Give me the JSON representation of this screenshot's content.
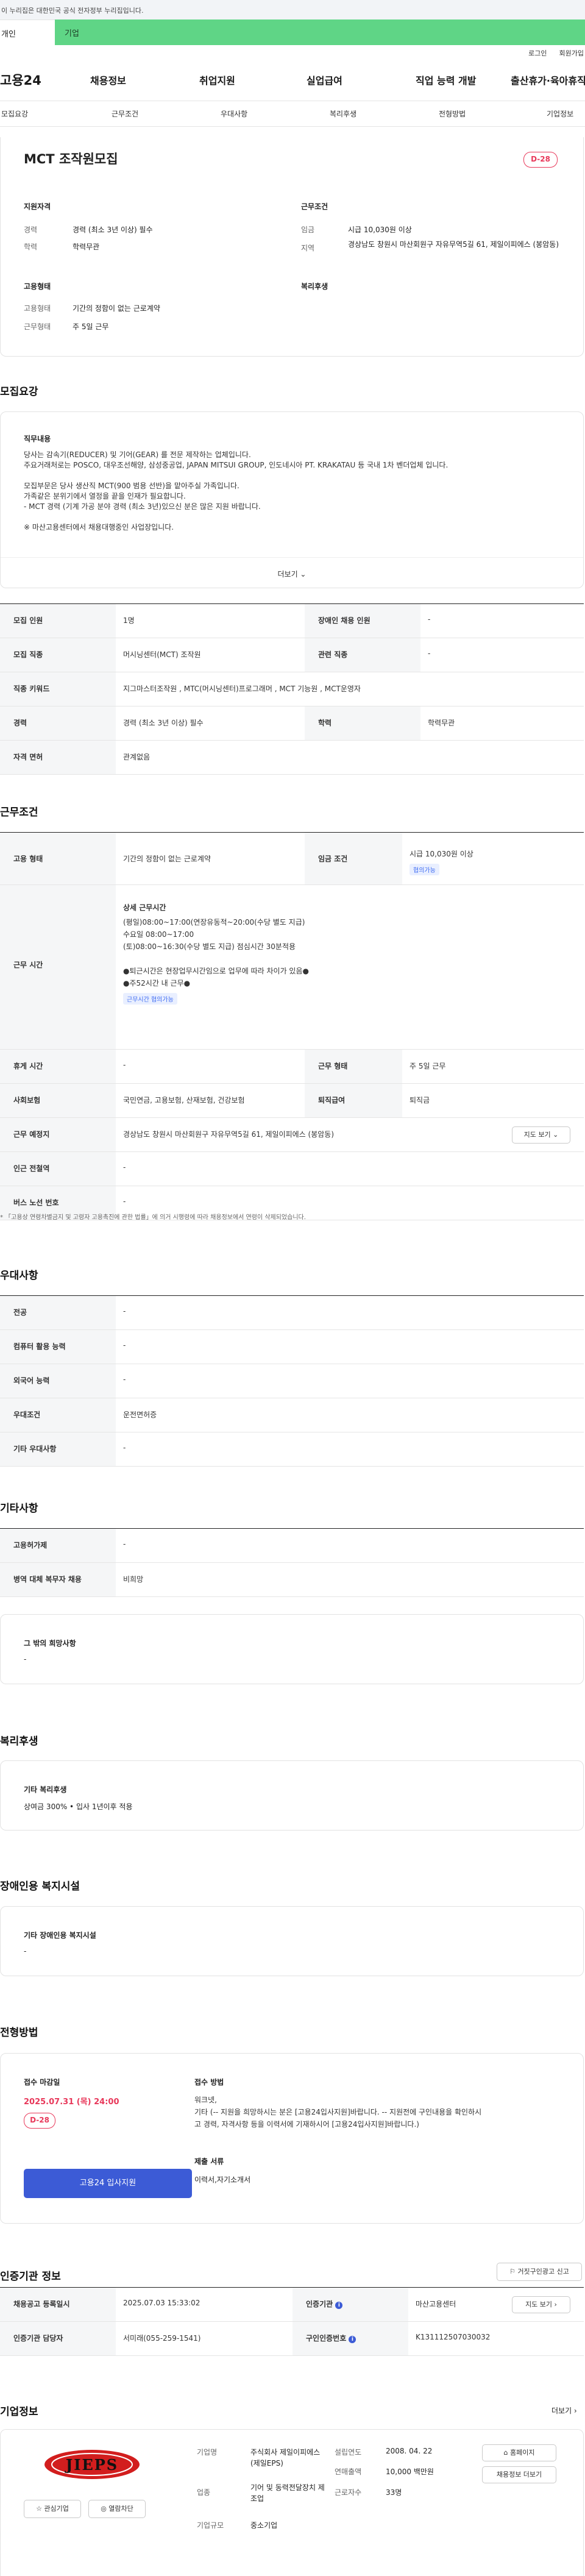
{
  "notice": "이 누리집은 대한민국 공식 전자정부 누리집입니다.",
  "channel": {
    "tab1": "개인",
    "tab2": "기업"
  },
  "util": {
    "login": "로그인",
    "join": "회원가입"
  },
  "gnb": {
    "logo": "고용24",
    "menu": [
      "채용정보",
      "취업지원",
      "실업급여",
      "직업 능력 개발",
      "출산휴가·육아휴직"
    ]
  },
  "subnav": [
    "모집요강",
    "근무조건",
    "우대사항",
    "복리후생",
    "전형방법",
    "기업정보"
  ],
  "summary": {
    "title": "MCT 조작원모집",
    "dday": "D-28",
    "qual_h": "지원자격",
    "career_l": "경력",
    "career_v": "경력 (최소 3년 이상) 필수",
    "edu_l": "학력",
    "edu_v": "학력무관",
    "cond_h": "근무조건",
    "wage_l": "임금",
    "wage_v": "시급 10,030원 이상",
    "loc_l": "지역",
    "loc_v": "경상남도 창원시 마산회원구 자유무역5길 61, 제일이피에스 (봉암동)",
    "form_h": "고용형태",
    "emp_l": "고용형태",
    "emp_v": "기간의 정함이 없는 근로계약",
    "work_l": "근무형태",
    "work_v": "주 5일 근무",
    "welfare_h": "복리후생"
  },
  "recruit": {
    "title": "모집요강",
    "box_h": "직무내용",
    "lines": [
      "당사는 감속기(REDUCER) 및 기어(GEAR) 를 전문 제작하는 업체입니다.",
      "주요거래처로는 POSCO, 대우조선해양, 삼성중공업, JAPAN MITSUI GROUP, 인도네시아 PT. KRAKATAU 등 국내 1차 벤더업체 입니다.",
      "",
      "모집부문은 당사 생산직 MCT(900 범용 선반)을 맡아주실 가족입니다.",
      "가족같은 분위기에서 열정을 끝을 인재가 필요합니다.",
      "- MCT 경력 (기계 가공 분야 경력 (최소 3년)있으신 분은 많은 지원 바랍니다.",
      "",
      "※ 마산고용센터에서 채용대행중인 사업장입니다."
    ],
    "more": "더보기 ⌄",
    "rows": [
      [
        "모집 인원",
        "1명",
        "장애인 채용 인원",
        "-"
      ],
      [
        "모집 직종",
        "머시닝센터(MCT) 조작원",
        "관련 직종",
        "-"
      ],
      [
        "직종 키워드",
        "지그마스터조작원 , MTC(머시닝센터)프로그래머 , MCT 기능원 , MCT운영자",
        "",
        ""
      ],
      [
        "경력",
        "경력 (최소 3년 이상) 필수",
        "학력",
        "학력무관"
      ],
      [
        "자격 면허",
        "관계없음",
        "",
        ""
      ]
    ]
  },
  "cond": {
    "title": "근무조건",
    "emp_l": "고용 형태",
    "emp_v": "기간의 정함이 없는 근로계약",
    "wage_l": "임금 조건",
    "wage_v": "시급 10,030원 이상",
    "wage_pill": "협의가능",
    "time_l": "근무 시간",
    "time_h": "상세 근무시간",
    "time_lines": [
      "(평일)08:00~17:00(연장유동적~20:00(수당 별도 지급)",
      "수요일 08:00~17:00",
      "(토)08:00~16:30(수당 별도 지급) 점심시간 30분적용",
      "",
      "●퇴근시간은 현장업무시간임으로 업무에 따라 차이가 있음●",
      "●주52시간 내 근무●"
    ],
    "time_pill": "근무시간 협의가능",
    "rest_l": "휴게 시간",
    "rest_v": "-",
    "form_l": "근무 형태",
    "form_v": "주 5일 근무",
    "ins_l": "사회보험",
    "ins_v": "국민연금, 고용보험, 산재보험, 건강보험",
    "ret_l": "퇴직급여",
    "ret_v": "퇴직금",
    "place_l": "근무 예정지",
    "place_v": "경상남도 창원시 마산회원구 자유무역5길 61, 제일이피에스 (봉암동)",
    "map": "지도 보기 ⌄",
    "sub_l": "인근 전철역",
    "sub_v": "-",
    "bus_l": "버스 노선 번호",
    "bus_v": "-",
    "note": "* 「고용상 연령차별금지 및 고령자 고용촉진에 관한 법률」에 의거 시행령에 따라 채용정보에서 연령이 삭제되었습니다."
  },
  "pref": {
    "title": "우대사항",
    "rows": [
      [
        "전공",
        "-"
      ],
      [
        "컴퓨터 활용 능력",
        "-"
      ],
      [
        "외국어 능력",
        "-"
      ],
      [
        "우대조건",
        "운전면허증"
      ],
      [
        "기타 우대사항",
        "-"
      ]
    ]
  },
  "etc": {
    "title": "기타사항",
    "rows": [
      [
        "고용허가제",
        "-"
      ],
      [
        "병역 대체 복무자 채용",
        "비희망"
      ]
    ],
    "box_h": "그 밖의 희망사항",
    "box_v": "-"
  },
  "welfare": {
    "title": "복리후생",
    "box_h": "기타 복리후생",
    "box_v": "상여금 300% • 입사 1년이후 적용"
  },
  "disabled": {
    "title": "장애인용 복지시설",
    "box_h": "기타 장애인용 복지시설",
    "box_v": "-"
  },
  "process": {
    "title": "전형방법",
    "deadline_h": "접수 마감일",
    "deadline_v": "2025.07.31 (목) 24:00",
    "dday": "D-28",
    "apply": "고용24 입사지원",
    "method_h": "접수 방법",
    "method_lines": [
      "워크넷,",
      "기타 (-- 지원을 희망하시는 분은 [고용24입사지원]바랍니다. -- 지원전에 구인내용을 확인하시",
      "고 경력, 자격사항 등을 이력서에 기재하시어 [고용24입사지원]바랍니다.)"
    ],
    "docs_h": "제출 서류",
    "docs_v": "이력서,자기소개서"
  },
  "org": {
    "title": "인증기관 정보",
    "report": "거짓구인광고 신고",
    "rows": [
      [
        "채용공고 등록일시",
        "2025.07.03 15:33:02",
        "인증기관",
        "마산고용센터"
      ],
      [
        "인증기관 담당자",
        "서미래(055-259-1541)",
        "구인인증번호",
        "K131112507030032"
      ]
    ],
    "map": "지도 보기 ›"
  },
  "company": {
    "title": "기업정보",
    "more": "더보기 ›",
    "logo": "JIEPS",
    "fav": "☆ 관심기업",
    "block": "◎ 열람차단",
    "name_l": "기업명",
    "name_v": "주식회사 제일이피에스(제일EPS)",
    "ind_l": "업종",
    "ind_v": "기어 및 동력전달장치 제조업",
    "size_l": "기업규모",
    "size_v": "중소기업",
    "est_l": "설립연도",
    "est_v": "2008. 04. 22",
    "sales_l": "연매출액",
    "sales_v": "10,000 백만원",
    "emp_l": "근로자수",
    "emp_v": "33명",
    "home": "⌂ 홈페이지",
    "other": "채용정보 더보기"
  },
  "colors": {
    "accent": "#3c5bd6",
    "dday": "#e8385a",
    "green": "#5fd586"
  }
}
